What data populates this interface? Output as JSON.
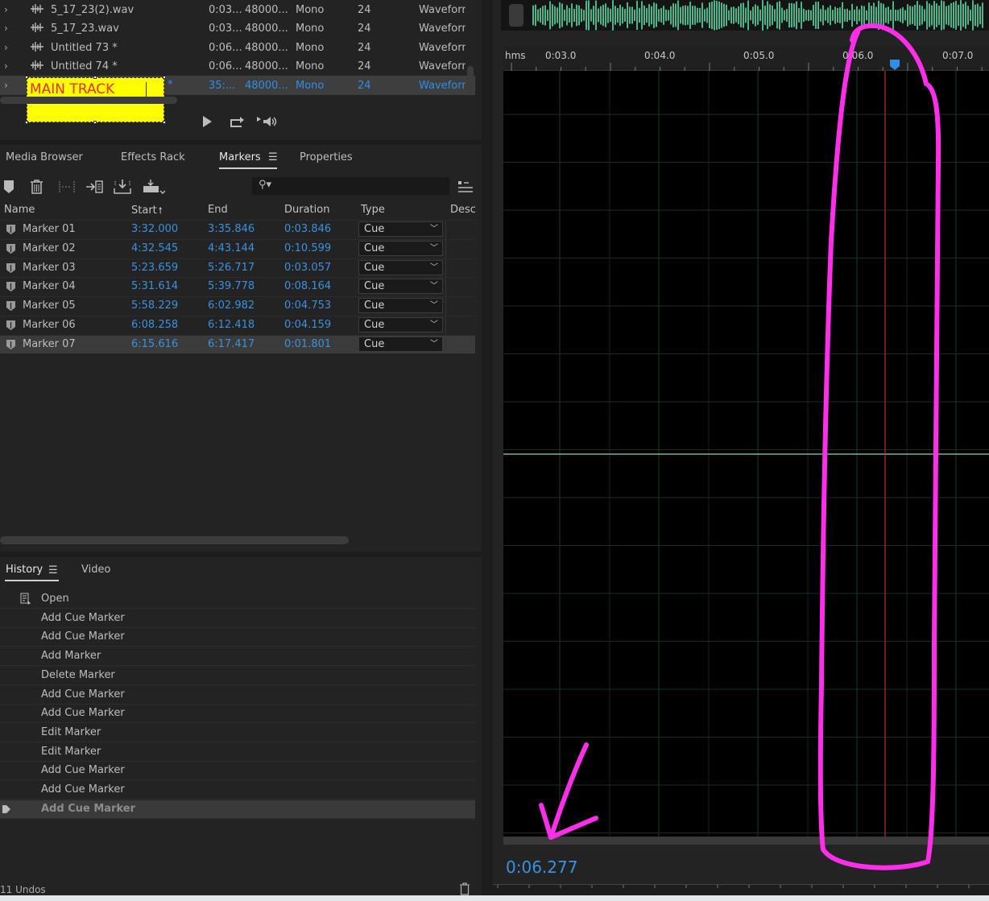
{
  "files": {
    "rows": [
      {
        "name": "5_17_23(2).wav",
        "duration": "0:03...",
        "rate": "48000...",
        "channels": "Mono",
        "bits": "24",
        "format": "Waveform"
      },
      {
        "name": "5_17_23.wav",
        "duration": "0:03...",
        "rate": "48000...",
        "channels": "Mono",
        "bits": "24",
        "format": "Waveform"
      },
      {
        "name": "Untitled 73 *",
        "duration": "0:06...",
        "rate": "48000...",
        "channels": "Mono",
        "bits": "24",
        "format": "Waveform"
      },
      {
        "name": "Untitled 74 *",
        "duration": "0:06...",
        "rate": "48000...",
        "channels": "Mono",
        "bits": "24",
        "format": "Waveform"
      },
      {
        "name": "",
        "duration": "35:...",
        "rate": "48000...",
        "channels": "Mono",
        "bits": "24",
        "format": "Waveform"
      }
    ],
    "rename_value": "MAIN TRACK",
    "selected_suffix": "*"
  },
  "markers_panel": {
    "tabs": [
      "Media Browser",
      "Effects Rack",
      "Markers",
      "Properties"
    ],
    "active_tab": "Markers",
    "search_placeholder": "",
    "columns": [
      "Name",
      "Start",
      "End",
      "Duration",
      "Type",
      "Desc"
    ],
    "rows": [
      {
        "name": "Marker 01",
        "start": "3:32.000",
        "end": "3:35.846",
        "duration": "0:03.846",
        "type": "Cue"
      },
      {
        "name": "Marker 02",
        "start": "4:32.545",
        "end": "4:43.144",
        "duration": "0:10.599",
        "type": "Cue"
      },
      {
        "name": "Marker 03",
        "start": "5:23.659",
        "end": "5:26.717",
        "duration": "0:03.057",
        "type": "Cue"
      },
      {
        "name": "Marker 04",
        "start": "5:31.614",
        "end": "5:39.778",
        "duration": "0:08.164",
        "type": "Cue"
      },
      {
        "name": "Marker 05",
        "start": "5:58.229",
        "end": "6:02.982",
        "duration": "0:04.753",
        "type": "Cue"
      },
      {
        "name": "Marker 06",
        "start": "6:08.258",
        "end": "6:12.418",
        "duration": "0:04.159",
        "type": "Cue"
      },
      {
        "name": "Marker 07",
        "start": "6:15.616",
        "end": "6:17.417",
        "duration": "0:01.801",
        "type": "Cue"
      }
    ]
  },
  "history_panel": {
    "tabs": [
      "History",
      "Video"
    ],
    "items": [
      "Open",
      "Add Cue Marker",
      "Add Cue Marker",
      "Add Marker",
      "Delete Marker",
      "Add Cue Marker",
      "Add Cue Marker",
      "Edit Marker",
      "Edit Marker",
      "Add Cue Marker",
      "Add Cue Marker",
      "Add Cue Marker"
    ],
    "undos": "11 Undos"
  },
  "editor": {
    "ruler_unit": "hms",
    "ruler_labels": [
      "0:03.0",
      "0:04.0",
      "0:05.0",
      "0:06.0",
      "0:07.0"
    ],
    "current_time": "0:06.277"
  },
  "colors": {
    "accent_blue": "#3a91e0",
    "waveform_green": "#58e0a8",
    "annotation_magenta": "#ff2ee8",
    "rename_yellow": "#ffff00",
    "rename_text": "#e53020",
    "playhead_red": "#c0282b"
  }
}
